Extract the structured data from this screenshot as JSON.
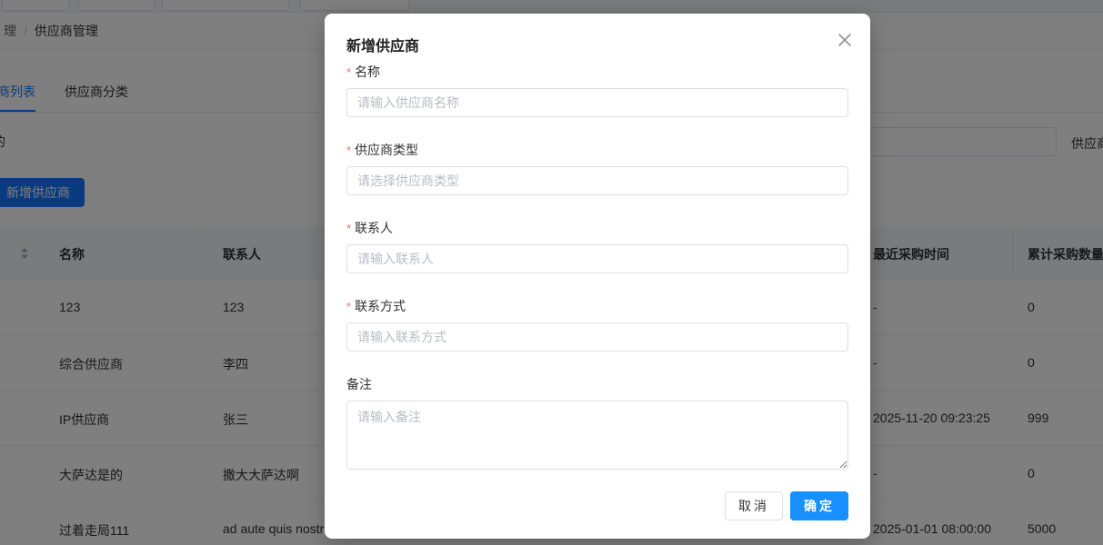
{
  "breadcrumb": {
    "parent": "理",
    "separator": "/",
    "current": "供应商管理"
  },
  "tabs": [
    {
      "label": "供应商列表",
      "active": true
    },
    {
      "label": "供应商分类",
      "active": false
    }
  ],
  "filters": {
    "left_label_fragment": "的",
    "right_label": "供应商"
  },
  "toolbar": {
    "add_label": "新增供应商"
  },
  "table": {
    "headers": {
      "name": "名称",
      "contact": "联系人",
      "last_purchase": "最近采购时间",
      "total_qty": "累计采购数量"
    },
    "rows": [
      {
        "name": "123",
        "contact": "123",
        "last_purchase": "-",
        "total_qty": "0"
      },
      {
        "name": "综合供应商",
        "contact": "李四",
        "last_purchase": "-",
        "total_qty": "0"
      },
      {
        "name": "IP供应商",
        "contact": "张三",
        "last_purchase": "2025-11-20 09:23:25",
        "total_qty": "999"
      },
      {
        "name": "大萨达是的",
        "contact": "撒大大萨达啊",
        "last_purchase": "-",
        "total_qty": "0"
      },
      {
        "name": "过着走局111",
        "contact": "ad aute quis nostr",
        "last_purchase": "2025-01-01 08:00:00",
        "total_qty": "5000"
      }
    ]
  },
  "dialog": {
    "title": "新增供应商",
    "required_mark": "*",
    "fields": {
      "name": {
        "label": "名称",
        "placeholder": "请输入供应商名称",
        "value": ""
      },
      "type": {
        "label": "供应商类型",
        "placeholder": "请选择供应商类型",
        "value": ""
      },
      "contact": {
        "label": "联系人",
        "placeholder": "请输入联系人",
        "value": ""
      },
      "phone": {
        "label": "联系方式",
        "placeholder": "请输入联系方式",
        "value": ""
      },
      "remark": {
        "label": "备注",
        "placeholder": "请输入备注",
        "value": ""
      }
    },
    "cancel_label": "取消",
    "confirm_label": "确定"
  },
  "colors": {
    "primary": "#1890ff",
    "required": "#f56c6c",
    "mask": "rgba(0,0,0,0.5)"
  },
  "icons": {
    "close": "close-icon",
    "sort": "sort-icon"
  }
}
